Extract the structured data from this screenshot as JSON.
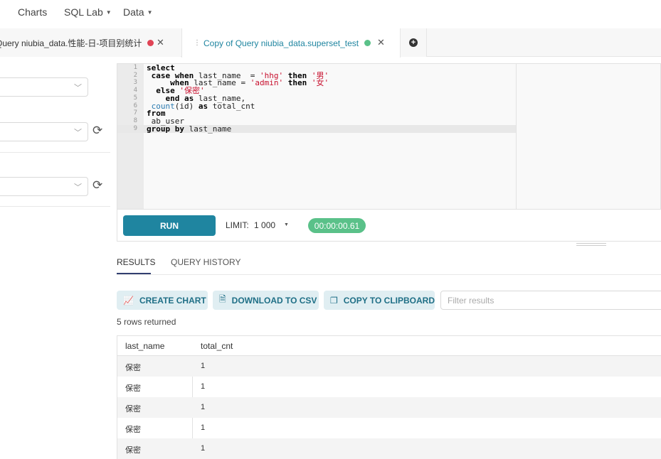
{
  "nav": {
    "charts": "Charts",
    "sql_lab": "SQL Lab",
    "data": "Data"
  },
  "tabs": [
    {
      "label": "Query niubia_data.性能-日-项目别统计",
      "status_color": "#e04355"
    },
    {
      "label": "Copy of Query niubia_data.superset_test",
      "status_color": "#5ac189"
    }
  ],
  "editor": {
    "line_numbers": [
      "1",
      "2",
      "3",
      "4",
      "5",
      "6",
      "7",
      "8",
      "9"
    ]
  },
  "runbar": {
    "run_label": "RUN",
    "limit_label": "LIMIT:",
    "limit_value": "1 000",
    "timer": "00:00:00.61"
  },
  "results": {
    "tab_results": "RESULTS",
    "tab_history": "QUERY HISTORY",
    "create_chart": "CREATE CHART",
    "download_csv": "DOWNLOAD TO CSV",
    "copy_clipboard": "COPY TO CLIPBOARD",
    "filter_placeholder": "Filter results",
    "rows_returned": "5 rows returned",
    "columns": [
      "last_name",
      "total_cnt"
    ],
    "rows": [
      [
        "保密",
        "1"
      ],
      [
        "保密",
        "1"
      ],
      [
        "保密",
        "1"
      ],
      [
        "保密",
        "1"
      ],
      [
        "保密",
        "1"
      ]
    ]
  },
  "colors": {
    "run_button": "#1f85a0",
    "timer_badge": "#5ac189",
    "action_button_bg": "#e0eef2"
  }
}
